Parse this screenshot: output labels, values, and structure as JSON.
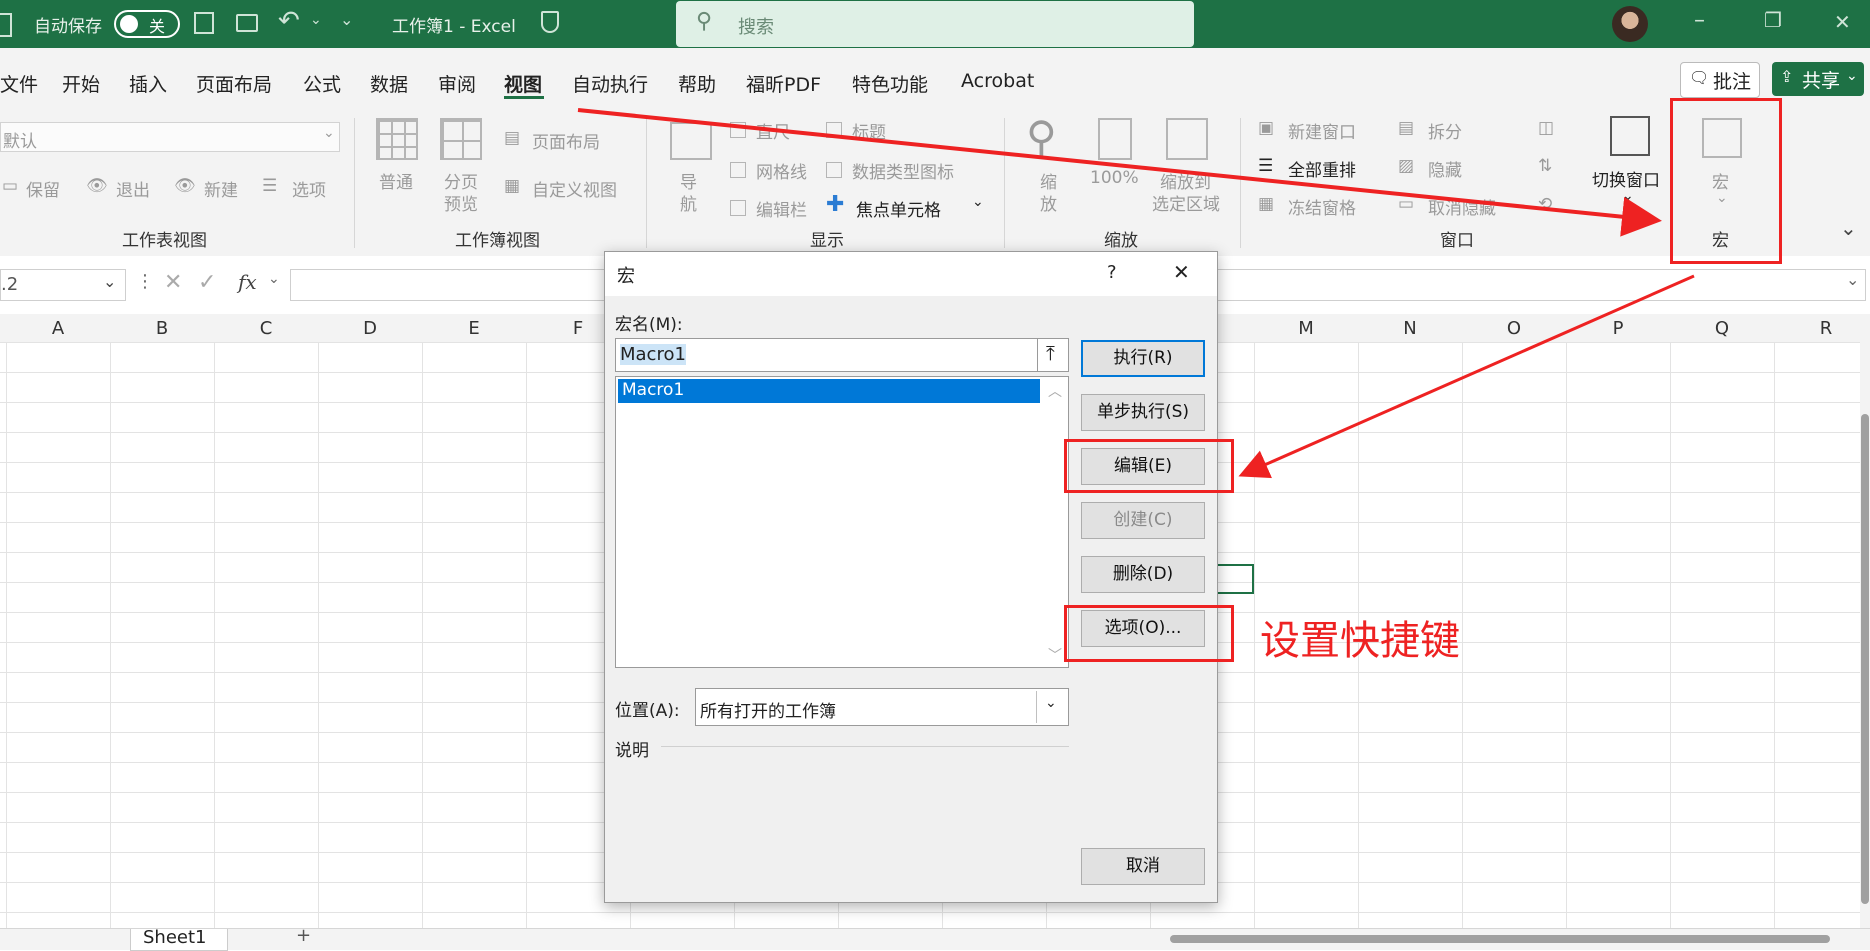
{
  "titlebar": {
    "autosave_label": "自动保存",
    "autosave_state": "关",
    "title": "工作簿1 - Excel",
    "search_placeholder": "搜索",
    "minimize": "–",
    "restore": "❐",
    "close": "✕"
  },
  "tabs": [
    "文件",
    "开始",
    "插入",
    "页面布局",
    "公式",
    "数据",
    "审阅",
    "视图",
    "自动执行",
    "帮助",
    "福昕PDF",
    "特色功能",
    "Acrobat"
  ],
  "active_tab": "视图",
  "comment_btn": "批注",
  "share_btn": "共享",
  "ribbon": {
    "sheet_view": {
      "dropdown": "默认",
      "keep": "保留",
      "exit": "退出",
      "new": "新建",
      "options": "选项",
      "label": "工作表视图"
    },
    "workbook_view": {
      "normal": "普通",
      "page_break_1": "分页",
      "page_break_2": "预览",
      "page_layout": "页面布局",
      "custom_view": "自定义视图",
      "label": "工作簿视图"
    },
    "show": {
      "nav_1": "导",
      "nav_2": "航",
      "ruler": "直尺",
      "gridlines": "网格线",
      "formula_bar": "编辑栏",
      "headings": "标题",
      "data_type_icons": "数据类型图标",
      "focus_cell": "焦点单元格",
      "label": "显示"
    },
    "zoom": {
      "zoom_1": "缩",
      "zoom_2": "放",
      "pct": "100%",
      "zoom_sel_1": "缩放到",
      "zoom_sel_2": "选定区域",
      "label": "缩放"
    },
    "window": {
      "new_window": "新建窗口",
      "arrange_all": "全部重排",
      "freeze": "冻结窗格",
      "split": "拆分",
      "hide": "隐藏",
      "unhide": "取消隐藏",
      "switch": "切换窗口",
      "label": "窗口"
    },
    "macro": {
      "label_top": "宏",
      "label": "宏"
    }
  },
  "formula_bar": {
    "namebox": ".2",
    "fx": "fx"
  },
  "columns": [
    "A",
    "B",
    "C",
    "D",
    "E",
    "F",
    "M",
    "N",
    "O",
    "P",
    "Q",
    "R"
  ],
  "sheet_tab": "Sheet1",
  "add_sheet": "+",
  "dialog": {
    "title": "宏",
    "help": "?",
    "close": "✕",
    "name_label": "宏名(M):",
    "name_value": "Macro1",
    "list_items": [
      "Macro1"
    ],
    "buttons": {
      "run": "执行(R)",
      "step": "单步执行(S)",
      "edit": "编辑(E)",
      "create": "创建(C)",
      "delete": "删除(D)",
      "options": "选项(O)...",
      "cancel": "取消"
    },
    "location_label": "位置(A):",
    "location_value": "所有打开的工作簿",
    "desc_label": "说明"
  },
  "annotation": "设置快捷键",
  "colors": {
    "excel_green": "#1e7145",
    "accent_blue": "#0078d7",
    "annotation_red": "#ee2222"
  }
}
